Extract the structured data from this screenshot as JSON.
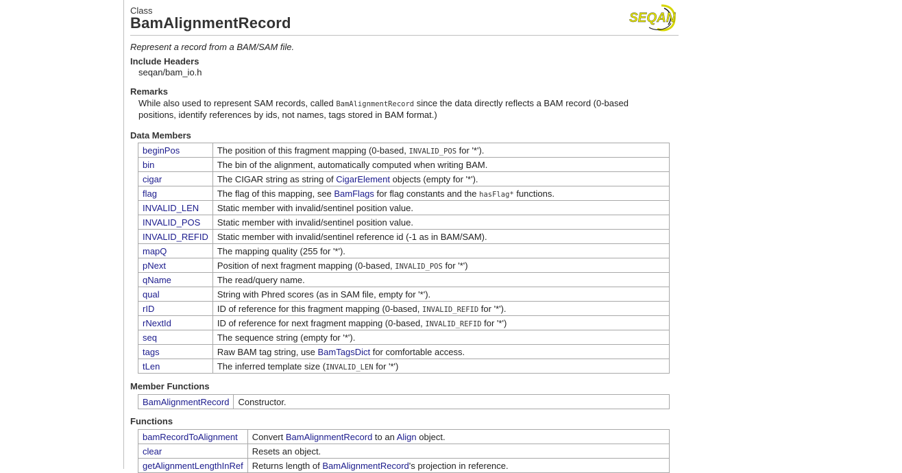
{
  "header": {
    "kind": "Class",
    "title": "BamAlignmentRecord",
    "logo_text": "SEQAN"
  },
  "brief": "Represent a record from a BAM/SAM file.",
  "include": {
    "heading": "Include Headers",
    "path": "seqan/bam_io.h"
  },
  "remarks": {
    "heading": "Remarks",
    "text_before": "While also used to represent SAM records, called ",
    "code": "BamAlignmentRecord",
    "text_after": " since the data directly reflects a BAM record (0-based",
    "line2": "positions, identify references by ids, not names, tags stored in BAM format.)"
  },
  "data_members": {
    "heading": "Data Members",
    "rows": [
      {
        "name": "beginPos",
        "desc": [
          {
            "t": "The position of this fragment mapping (0-based, "
          },
          {
            "c": "INVALID_POS"
          },
          {
            "t": " for '*')."
          }
        ]
      },
      {
        "name": "bin",
        "desc": [
          {
            "t": "The bin of the alignment, automatically computed when writing BAM."
          }
        ]
      },
      {
        "name": "cigar",
        "desc": [
          {
            "t": "The CIGAR string as string of "
          },
          {
            "l": "CigarElement"
          },
          {
            "t": " objects (empty for '*')."
          }
        ]
      },
      {
        "name": "flag",
        "desc": [
          {
            "t": "The flag of this mapping, see "
          },
          {
            "l": "BamFlags"
          },
          {
            "t": " for flag constants and the "
          },
          {
            "c": "hasFlag*"
          },
          {
            "t": " functions."
          }
        ]
      },
      {
        "name": "INVALID_LEN",
        "desc": [
          {
            "t": "Static member with invalid/sentinel position value."
          }
        ]
      },
      {
        "name": "INVALID_POS",
        "desc": [
          {
            "t": "Static member with invalid/sentinel position value."
          }
        ]
      },
      {
        "name": "INVALID_REFID",
        "desc": [
          {
            "t": "Static member with invalid/sentinel reference id (-1 as in BAM/SAM)."
          }
        ]
      },
      {
        "name": "mapQ",
        "desc": [
          {
            "t": "The mapping quality (255 for '*')."
          }
        ]
      },
      {
        "name": "pNext",
        "desc": [
          {
            "t": "Position of next fragment mapping (0-based, "
          },
          {
            "c": "INVALID_POS"
          },
          {
            "t": " for '*')"
          }
        ]
      },
      {
        "name": "qName",
        "desc": [
          {
            "t": "The read/query name."
          }
        ]
      },
      {
        "name": "qual",
        "desc": [
          {
            "t": "String with Phred scores (as in SAM file, empty for '*')."
          }
        ]
      },
      {
        "name": "rID",
        "desc": [
          {
            "t": "ID of reference for this fragment mapping (0-based, "
          },
          {
            "c": "INVALID_REFID"
          },
          {
            "t": " for '*')."
          }
        ]
      },
      {
        "name": "rNextId",
        "desc": [
          {
            "t": "ID of reference for next fragment mapping (0-based, "
          },
          {
            "c": "INVALID_REFID"
          },
          {
            "t": " for '*')"
          }
        ]
      },
      {
        "name": "seq",
        "desc": [
          {
            "t": "The sequence string (empty for '*')."
          }
        ]
      },
      {
        "name": "tags",
        "desc": [
          {
            "t": "Raw BAM tag string, use "
          },
          {
            "l": "BamTagsDict"
          },
          {
            "t": " for comfortable access."
          }
        ]
      },
      {
        "name": "tLen",
        "desc": [
          {
            "t": "The inferred template size ("
          },
          {
            "c": "INVALID_LEN"
          },
          {
            "t": " for '*')"
          }
        ]
      }
    ]
  },
  "member_functions": {
    "heading": "Member Functions",
    "rows": [
      {
        "name": "BamAlignmentRecord",
        "desc": [
          {
            "t": "Constructor."
          }
        ]
      }
    ]
  },
  "functions": {
    "heading": "Functions",
    "rows": [
      {
        "name": "bamRecordToAlignment",
        "desc": [
          {
            "t": "Convert "
          },
          {
            "l": "BamAlignmentRecord"
          },
          {
            "t": " to an "
          },
          {
            "l": "Align"
          },
          {
            "t": " object."
          }
        ]
      },
      {
        "name": "clear",
        "desc": [
          {
            "t": "Resets an object."
          }
        ]
      },
      {
        "name": "getAlignmentLengthInRef",
        "desc": [
          {
            "t": "Returns length of "
          },
          {
            "l": "BamAlignmentRecord"
          },
          {
            "t": "'s projection in reference."
          }
        ]
      }
    ]
  },
  "colors": {
    "link": "#1a1a8c",
    "border": "#a8a8a8",
    "logo_yellow": "#e3e300"
  }
}
